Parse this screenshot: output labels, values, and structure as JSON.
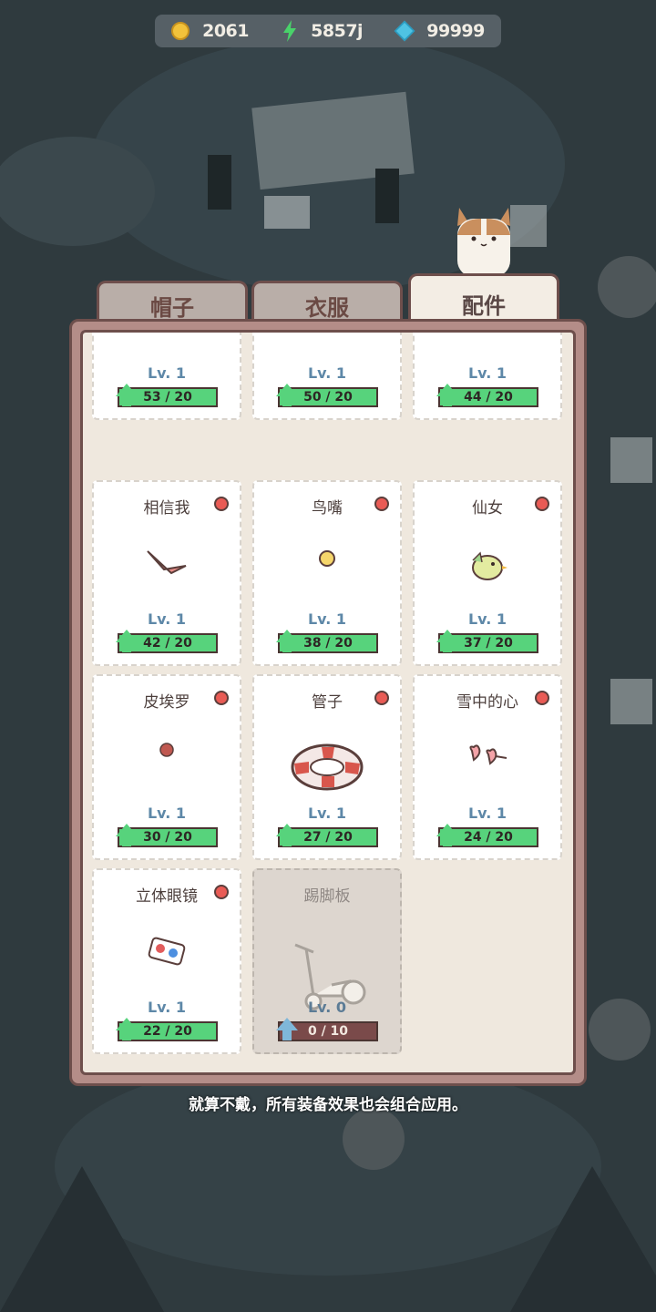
{
  "topbar": {
    "gold": "2061",
    "energy": "5857j",
    "gems": "99999"
  },
  "tabs": [
    "帽子",
    "衣服",
    "配件"
  ],
  "active_tab": "配件",
  "cards": [
    {
      "name": "",
      "level": "Lv. 1",
      "progress": "53 / 20",
      "icon": "wings-icon",
      "badge": false,
      "locked": false
    },
    {
      "name": "",
      "level": "Lv. 1",
      "progress": "50 / 20",
      "icon": "feathers-icon",
      "badge": false,
      "locked": false
    },
    {
      "name": "",
      "level": "Lv. 1",
      "progress": "44 / 20",
      "icon": "collar-icon",
      "badge": false,
      "locked": false
    },
    {
      "name": "相信我",
      "level": "Lv. 1",
      "progress": "42 / 20",
      "icon": "beak-icon",
      "badge": true,
      "locked": false
    },
    {
      "name": "鸟嘴",
      "level": "Lv. 1",
      "progress": "38 / 20",
      "icon": "chick-icon",
      "badge": true,
      "locked": false
    },
    {
      "name": "仙女",
      "level": "Lv. 1",
      "progress": "37 / 20",
      "icon": "bird-icon",
      "badge": true,
      "locked": false
    },
    {
      "name": "皮埃罗",
      "level": "Lv. 1",
      "progress": "30 / 20",
      "icon": "clown-nose-icon",
      "badge": true,
      "locked": false
    },
    {
      "name": "管子",
      "level": "Lv. 1",
      "progress": "27 / 20",
      "icon": "swim-ring-icon",
      "badge": true,
      "locked": false
    },
    {
      "name": "雪中的心",
      "level": "Lv. 1",
      "progress": "24 / 20",
      "icon": "heart-glasses-icon",
      "badge": true,
      "locked": false
    },
    {
      "name": "立体眼镜",
      "level": "Lv. 1",
      "progress": "22 / 20",
      "icon": "3d-glasses-icon",
      "badge": true,
      "locked": false
    },
    {
      "name": "踢脚板",
      "level": "Lv. 0",
      "progress": "0 / 10",
      "icon": "scooter-icon",
      "badge": false,
      "locked": true
    }
  ],
  "hint": "就算不戴，所有装备效果也会组合应用。",
  "colors": {
    "progress_green": "#57d37c",
    "locked_bar": "#7a4a4a",
    "badge_red": "#e95b55",
    "panel_border": "#6e4f4c"
  }
}
